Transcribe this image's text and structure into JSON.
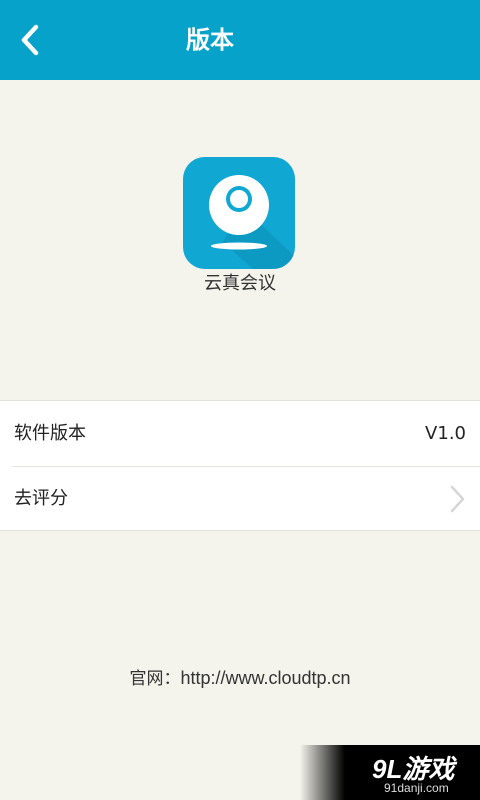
{
  "header": {
    "title": "版本",
    "back_icon": "chevron-left-icon",
    "background": "#06a2c9"
  },
  "app": {
    "icon": "webcam-icon",
    "name": "云真会议"
  },
  "settings": {
    "version_label": "软件版本",
    "version_value": "V1.0",
    "rate_label": "去评分",
    "rate_icon": "chevron-right-icon"
  },
  "footer": {
    "website_label": "官网：",
    "website_url": "http://www.cloudtp.cn"
  },
  "watermark": {
    "brand": "9L游戏",
    "site": "91danji.com"
  }
}
